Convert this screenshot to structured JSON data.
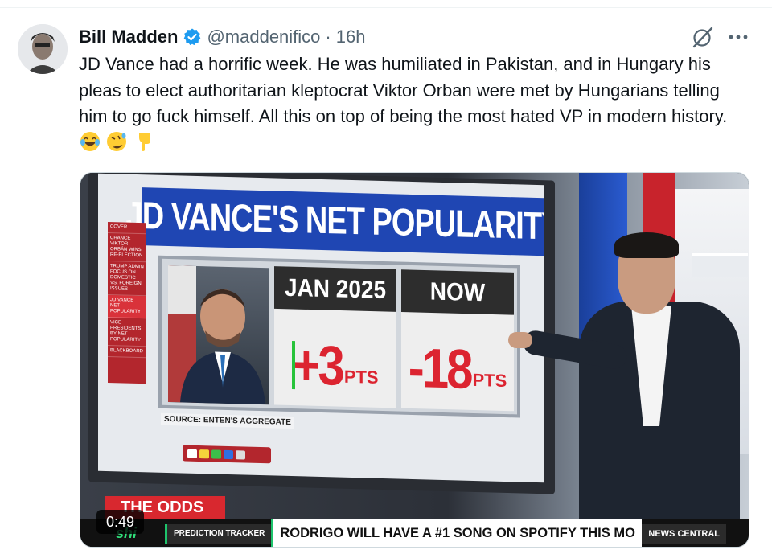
{
  "tweet": {
    "display_name": "Bill Madden",
    "handle": "@maddenifico",
    "separator": "·",
    "time": "16h",
    "text": "JD Vance had a horrific week. He was humiliated in Pakistan, and in Hungary his pleas to elect authoritarian kleptocrat Viktor Orban were met by Hungarians telling him to go fuck himself. All this on top of being the most hated VP in modern history.",
    "emojis": [
      "face-with-tears-of-joy-emoji",
      "rolling-on-floor-laughing-emoji",
      "backhand-index-pointing-down-emoji"
    ]
  },
  "media": {
    "duration": "0:49",
    "screen": {
      "title": "JD VANCE'S NET POPULARITY",
      "side_menu": [
        "COVER",
        "CHANCE VIKTOR ORBÁN WINS RE-ELECTION",
        "TRUMP ADMIN FOCUS ON DOMESTIC VS. FOREIGN ISSUES",
        "JD VANCE NET POPULARITY",
        "VICE PRESIDENTS BY NET POPULARITY",
        "BLACKBOARD"
      ],
      "col_jan": {
        "label": "JAN 2025",
        "value": "+3",
        "unit": "PTS"
      },
      "col_now": {
        "label": "NOW",
        "value": "-18",
        "unit": "PTS"
      },
      "source": "SOURCE: ENTEN'S AGGREGATE"
    },
    "chyron": {
      "odds": "THE ODDS",
      "brand": "shi",
      "tracker": "PREDICTION TRACKER",
      "headline": "RODRIGO WILL HAVE A #1 SONG ON SPOTIFY THIS MO",
      "network": "NEWS CENTRAL"
    }
  },
  "colors": {
    "verified_blue": "#1d9bf0",
    "screen_red": "#dc2430",
    "title_blue": "#1f46b3"
  }
}
